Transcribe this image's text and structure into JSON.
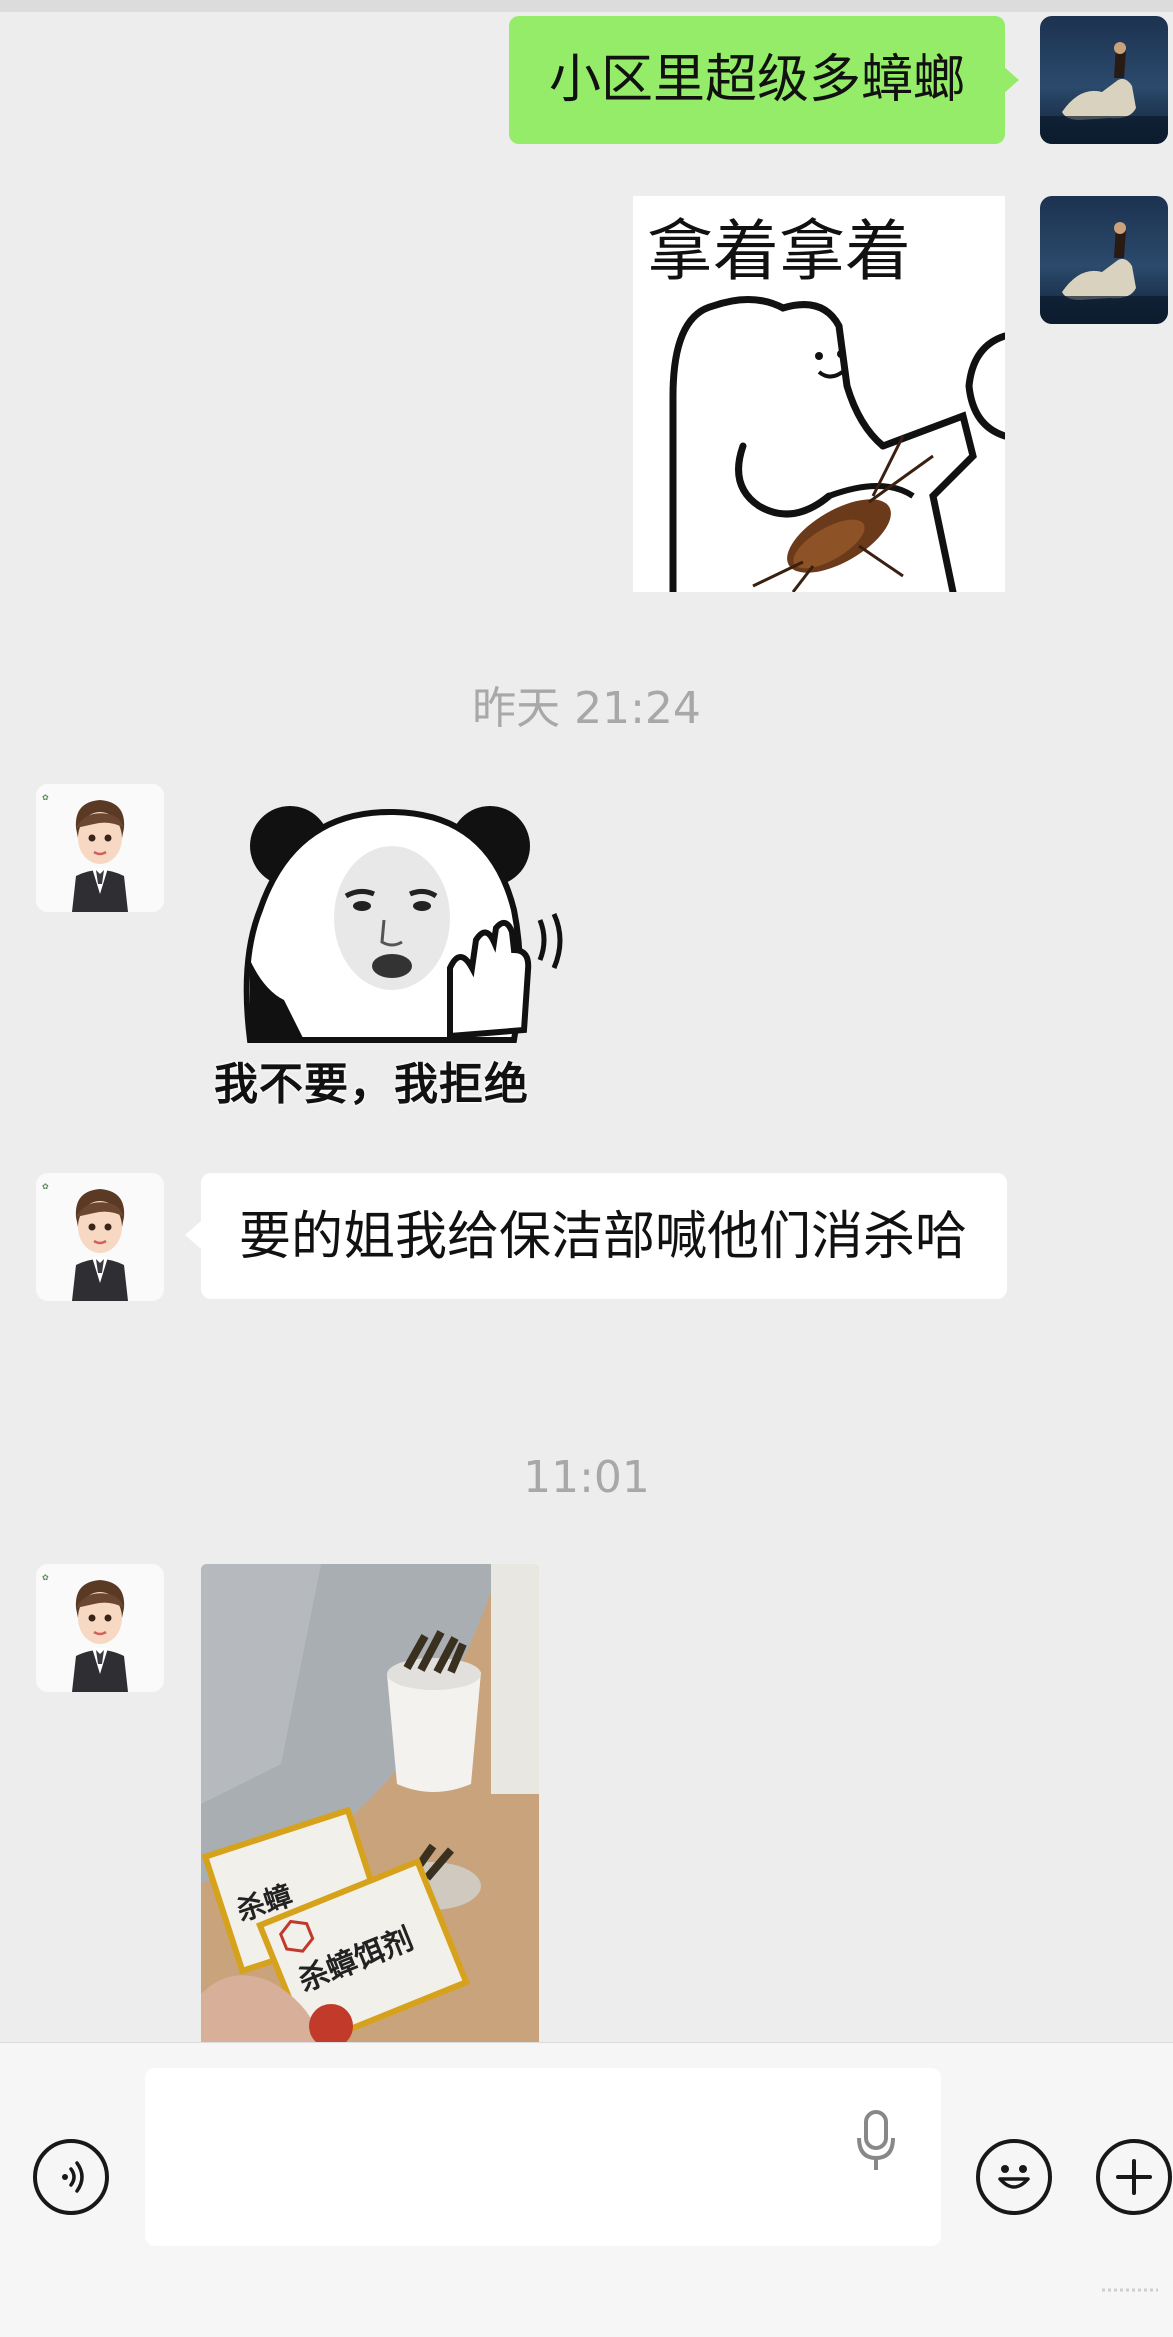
{
  "messages": {
    "sent_text": "小区里超级多蟑螂",
    "sent_sticker_text": "拿着拿着",
    "time_1": "昨天 21:24",
    "received_sticker_caption": "我不要，我拒绝",
    "received_text": "要的姐我给保洁部喊他们消杀哈",
    "time_2": "11:01",
    "photo_label_1": "杀蟑饵剂",
    "photo_label_2": "杀蟑"
  },
  "input_bar": {
    "placeholder": "",
    "voice_icon": "voice-wave-icon",
    "mic_icon": "microphone-icon",
    "emoji_icon": "smiley-icon",
    "plus_icon": "plus-icon"
  },
  "colors": {
    "sent_bubble": "#95ec69",
    "received_bubble": "#ffffff",
    "background": "#ededed",
    "timestamp": "#a8a8a8"
  }
}
